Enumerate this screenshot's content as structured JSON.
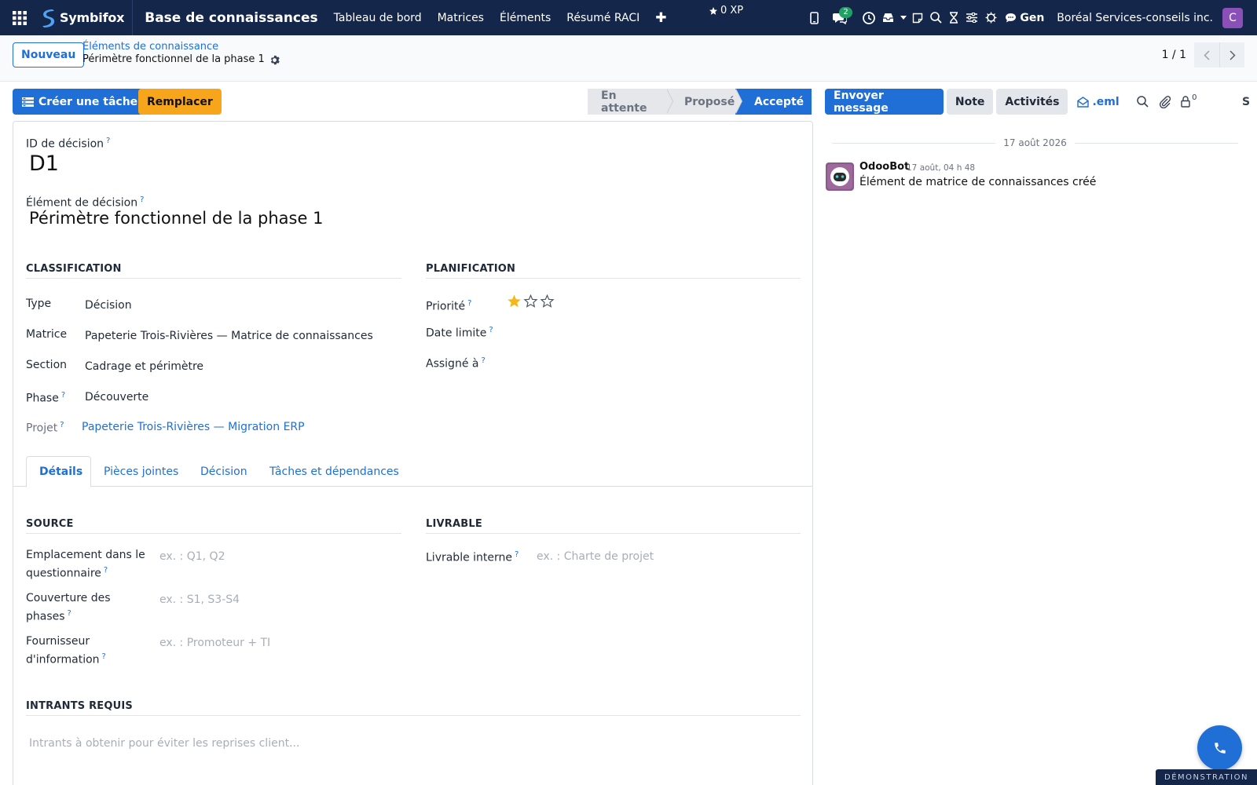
{
  "navbar": {
    "brand": "Symbifox",
    "app_title": "Base de connaissances",
    "menu": [
      "Tableau de bord",
      "Matrices",
      "Éléments",
      "Résumé RACI"
    ],
    "plus": "✚",
    "xp": "0 XP",
    "chat_badge": "2",
    "gen": "Gen",
    "company": "Boréal Services-conseils inc.",
    "avatar_letter": "C"
  },
  "control": {
    "new_button": "Nouveau",
    "breadcrumb_parent": "Éléments de connaissance",
    "breadcrumb_current": "Périmètre fonctionnel de la phase 1",
    "pager": "1 / 1"
  },
  "actions": {
    "create_task": "Créer une tâche",
    "replace": "Remplacer",
    "stages": [
      "En attente",
      "Proposé",
      "Accepté"
    ],
    "active_stage": "Accepté"
  },
  "form": {
    "id_label": "ID de décision",
    "id_value": "D1",
    "name_label": "Élément de décision",
    "name_value": "Périmètre fonctionnel de la phase 1",
    "classification": {
      "title": "CLASSIFICATION",
      "type_label": "Type",
      "type_value": "Décision",
      "matrix_label": "Matrice",
      "matrix_value": "Papeterie Trois-Rivières — Matrice de connaissances",
      "section_label": "Section",
      "section_value": "Cadrage et périmètre",
      "phase_label": "Phase",
      "phase_value": "Découverte",
      "project_label": "Projet",
      "project_value": "Papeterie Trois-Rivières — Migration ERP"
    },
    "planning": {
      "title": "PLANIFICATION",
      "priority_label": "Priorité",
      "priority_stars": 1,
      "priority_max": 3,
      "deadline_label": "Date limite",
      "assigned_label": "Assigné à"
    },
    "tabs": [
      "Détails",
      "Pièces jointes",
      "Décision",
      "Tâches et dépendances"
    ],
    "active_tab": "Détails",
    "source": {
      "title": "SOURCE",
      "location_label_1": "Emplacement dans le",
      "location_label_2": "questionnaire",
      "location_placeholder": "ex. : Q1, Q2",
      "coverage_label_1": "Couverture des",
      "coverage_label_2": "phases",
      "coverage_placeholder": "ex. : S1, S3-S4",
      "supplier_label_1": "Fournisseur",
      "supplier_label_2": "d'information",
      "supplier_placeholder": "ex. : Promoteur + TI"
    },
    "deliverable": {
      "title": "LIVRABLE",
      "internal_label": "Livrable interne",
      "internal_placeholder": "ex. : Charte de projet"
    },
    "inputs": {
      "title": "INTRANTS REQUIS",
      "placeholder": "Intrants à obtenir pour éviter les reprises client..."
    },
    "help_mark": "?"
  },
  "chatter": {
    "send_message": "Envoyer message",
    "note": "Note",
    "activities": "Activités",
    "eml": ".eml",
    "followers_count": "0",
    "s_label": "S",
    "date_divider": "17 août 2026",
    "message": {
      "author": "OdooBot",
      "time": "17 août, 04 h 48",
      "body": "Élément de matrice de connaissances créé"
    }
  },
  "footer": {
    "demo": "DÉMONSTRATION"
  },
  "colors": {
    "navbar": "#14264a",
    "primary": "#1f6fd6",
    "warning": "#f7a61b",
    "star": "#f3b81a"
  }
}
